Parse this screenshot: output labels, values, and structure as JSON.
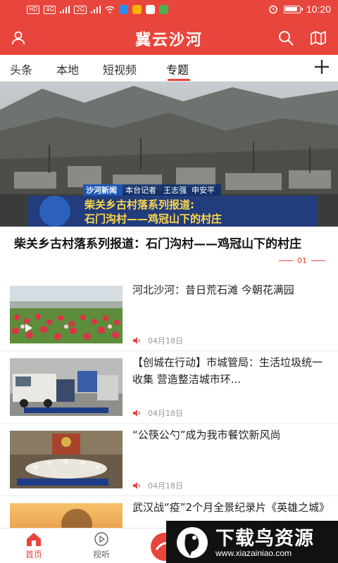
{
  "status_bar": {
    "network_badges": [
      "HD",
      "4G",
      "2G"
    ],
    "time": "10:20"
  },
  "header": {
    "title": "冀云沙河",
    "left_icon": "user-icon",
    "right_icons": [
      "search-icon",
      "map-icon"
    ]
  },
  "tabs": [
    {
      "label": "头条",
      "active": false
    },
    {
      "label": "本地",
      "active": false
    },
    {
      "label": "短视频",
      "active": false
    },
    {
      "label": "专题",
      "active": true
    }
  ],
  "hero": {
    "overlay_lines": [
      "沙河新闻",
      "本台记者",
      "王志强",
      "申安平"
    ],
    "overlay_caption_1": "柴关乡古村落系列报道:",
    "overlay_caption_2": "石门沟村——鸡冠山下的村庄",
    "title": "柴关乡古村落系列报道：石门沟村——鸡冠山下的村庄",
    "page_indicator": "01"
  },
  "news": [
    {
      "title": "河北沙河：昔日荒石滩 今朝花满园",
      "date": "04月18日",
      "has_audio": true,
      "is_video": true
    },
    {
      "title": "【创城在行动】市城管局：生活垃圾统一收集 营造整洁城市环...",
      "date": "04月18日",
      "has_audio": true,
      "is_video": false
    },
    {
      "title": "“公筷公勺”成为我市餐饮新风尚",
      "date": "04月18日",
      "has_audio": true,
      "is_video": false
    },
    {
      "title": "武汉战“疫”2个月全景纪录片《英雄之城》",
      "date": "",
      "has_audio": false,
      "is_video": false
    }
  ],
  "bottom_nav": [
    {
      "label": "首页",
      "icon": "home-icon",
      "active": true
    },
    {
      "label": "视听",
      "icon": "play-circle-icon",
      "active": false
    }
  ],
  "watermark": {
    "text": "下载鸟资源",
    "url": "www.xiazainiao.com"
  },
  "colors": {
    "brand_red": "#e8453c",
    "date_gray": "#999999"
  }
}
